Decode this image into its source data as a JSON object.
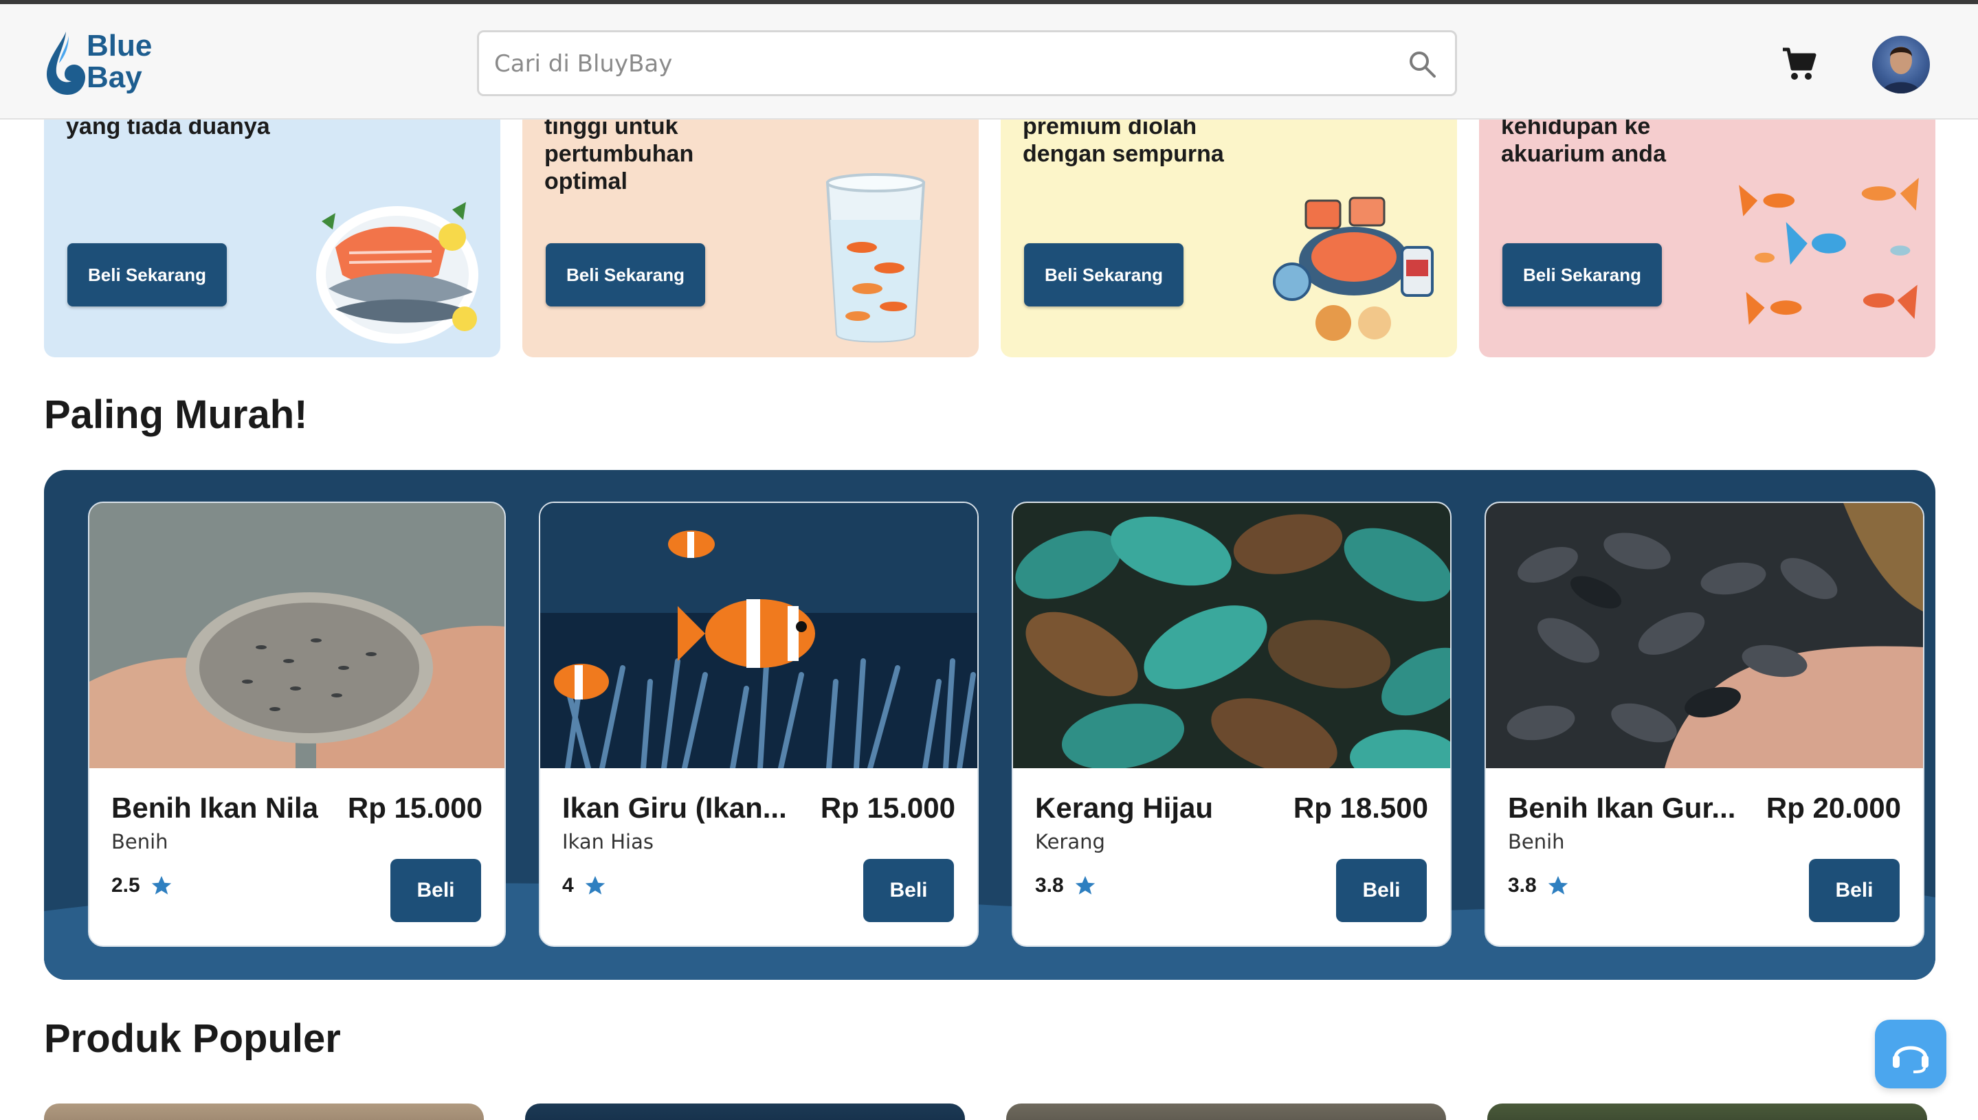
{
  "header": {
    "logo_line1": "Blue",
    "logo_line2": "Bay",
    "search_placeholder": "Cari di BluyBay",
    "icons": [
      "search-icon",
      "cart-icon",
      "avatar"
    ]
  },
  "promos": [
    {
      "text": "yang tiada duanya",
      "button": "Beli Sekarang",
      "bg": "#d6e8f7"
    },
    {
      "text": "tinggi untuk\npertumbuhan\noptimal",
      "button": "Beli Sekarang",
      "bg": "#f9dfcb"
    },
    {
      "text": "premium diolah\ndengan sempurna",
      "button": "Beli Sekarang",
      "bg": "#fcf5c9"
    },
    {
      "text": "kehidupan ke\nakuarium anda",
      "button": "Beli Sekarang",
      "bg": "#f5cdce"
    }
  ],
  "cheapest": {
    "title": "Paling Murah!",
    "products": [
      {
        "name": "Benih Ikan Nila",
        "price": "Rp 15.000",
        "category": "Benih",
        "rating": "2.5",
        "button": "Beli"
      },
      {
        "name": "Ikan Giru (Ikan...",
        "price": "Rp 15.000",
        "category": "Ikan Hias",
        "rating": "4",
        "button": "Beli"
      },
      {
        "name": "Kerang Hijau",
        "price": "Rp 18.500",
        "category": "Kerang",
        "rating": "3.8",
        "button": "Beli"
      },
      {
        "name": "Benih Ikan Gur...",
        "price": "Rp 20.000",
        "category": "Benih",
        "rating": "3.8",
        "button": "Beli"
      }
    ]
  },
  "popular": {
    "title": "Produk Populer"
  },
  "colors": {
    "primary": "#1d4f78",
    "panel": "#1d4466",
    "support": "#4ba6ee"
  }
}
